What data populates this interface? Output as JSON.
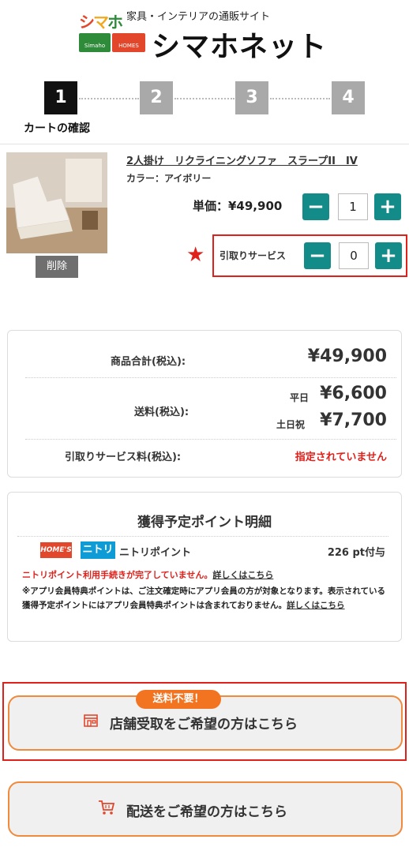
{
  "header": {
    "logo_small": [
      "シ",
      "マ",
      "ホ"
    ],
    "tagline": "家具・インテリアの通販サイト",
    "badge_left": "Simaho",
    "badge_right": "HOMES",
    "site_name": "シマホネット"
  },
  "steps": {
    "items": [
      "1",
      "2",
      "3",
      "4"
    ],
    "active_label": "カートの確認"
  },
  "product": {
    "name": "2人掛け　リクライニングソファ　スラープII　IV",
    "color": "カラー：アイボリー",
    "delete_label": "削除",
    "unit_price": "単価：¥49,900",
    "quantity": "1",
    "removal_label": "引取りサービス",
    "removal_quantity": "0",
    "minus": "−",
    "plus": "+",
    "star": "★"
  },
  "summary": {
    "subtotal_label": "商品合計(税込):",
    "subtotal_value": "¥49,900",
    "shipping_label": "送料(税込):",
    "weekday_label": "平日",
    "weekday_value": "¥6,600",
    "weekend_label": "土日祝",
    "weekend_value": "¥7,700",
    "removal_fee_label": "引取りサービス料(税込):",
    "removal_fee_value": "指定されていません"
  },
  "points": {
    "title": "獲得予定ポイント明細",
    "homes_logo": "HOME'S",
    "nitori_logo": "ニトリ",
    "nitori_text": "ニトリポイント",
    "value": "226 pt付与",
    "warning": "ニトリポイント利用手続きが完了していません。",
    "warning_link": "詳しくはこちら",
    "note": "※アプリ会員特典ポイントは、ご注文確定時にアプリ会員の方が対象となります。表示されている獲得予定ポイントにはアプリ会員特典ポイントは含まれておりません。",
    "note_link": "詳しくはこちら"
  },
  "store_pickup": {
    "tag": "送料不要！",
    "label": "店舗受取をご希望の方はこちら"
  },
  "delivery": {
    "label": "配送をご希望の方はこちら"
  },
  "colors": {
    "teal": "#138b88",
    "red": "#e0201b",
    "orange": "#f27421",
    "orange_border": "#f08a3c"
  }
}
